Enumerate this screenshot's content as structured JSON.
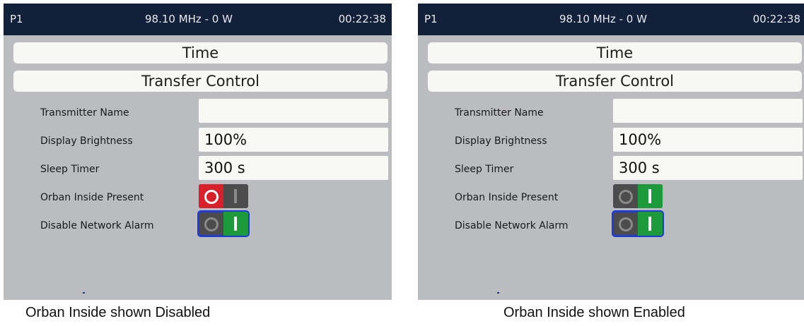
{
  "screens": [
    {
      "header": {
        "program": "P1",
        "frequency_power": "98.10 MHz - 0 W",
        "clock": "00:22:38"
      },
      "menu": {
        "time_label": "Time",
        "transfer_label": "Transfer Control"
      },
      "settings": {
        "transmitter_name_label": "Transmitter Name",
        "transmitter_name_value": "",
        "display_brightness_label": "Display Brightness",
        "display_brightness_value": "100%",
        "sleep_timer_label": "Sleep Timer",
        "sleep_timer_value": "300 s",
        "orban_inside_label": "Orban Inside Present",
        "orban_inside_state": "off",
        "network_alarm_label": "Disable Network Alarm",
        "network_alarm_state": "on"
      },
      "caption": "Orban Inside shown Disabled"
    },
    {
      "header": {
        "program": "P1",
        "frequency_power": "98.10 MHz - 0 W",
        "clock": "00:22:38"
      },
      "menu": {
        "time_label": "Time",
        "transfer_label": "Transfer Control"
      },
      "settings": {
        "transmitter_name_label": "Transmitter Name",
        "transmitter_name_value": "",
        "display_brightness_label": "Display Brightness",
        "display_brightness_value": "100%",
        "sleep_timer_label": "Sleep Timer",
        "sleep_timer_value": "300 s",
        "orban_inside_label": "Orban Inside Present",
        "orban_inside_state": "on",
        "network_alarm_label": "Disable Network Alarm",
        "network_alarm_state": "on"
      },
      "caption": "Orban Inside shown Enabled"
    }
  ],
  "colors": {
    "header_bg": "#13203a",
    "panel_bg": "#babcc0",
    "toggle_off_red": "#d81f2a",
    "toggle_on_green": "#1c9a3c",
    "focus_blue": "#1f3bd8"
  },
  "icons": {
    "toggle_off": "circle-icon",
    "toggle_on": "bar-icon"
  }
}
